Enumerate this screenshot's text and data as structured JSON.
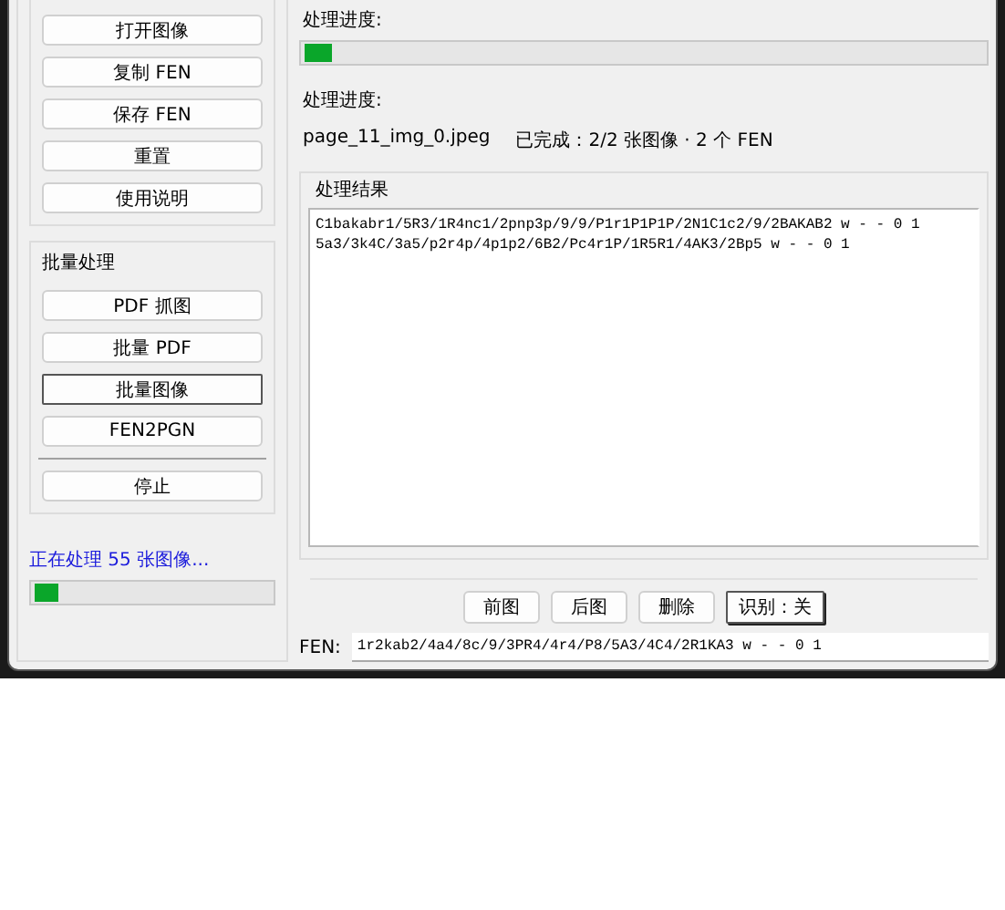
{
  "left_panel": {
    "top_buttons": [
      {
        "label": "打开图像",
        "focused": false
      },
      {
        "label": "复制 FEN",
        "focused": false
      },
      {
        "label": "保存 FEN",
        "focused": false
      },
      {
        "label": "重置",
        "focused": false
      },
      {
        "label": "使用说明",
        "focused": false
      }
    ],
    "batch_group": {
      "title": "批量处理",
      "buttons": [
        {
          "label": "PDF 抓图",
          "focused": false
        },
        {
          "label": "批量 PDF",
          "focused": false
        },
        {
          "label": "批量图像",
          "focused": true
        },
        {
          "label": "FEN2PGN",
          "focused": false
        }
      ],
      "stop_button": {
        "label": "停止",
        "focused": false
      }
    },
    "status": {
      "text": "正在处理 55 张图像...",
      "level": 0.1
    }
  },
  "main": {
    "progress_label": "处理进度:",
    "progress": {
      "level": 0.04
    },
    "progress_label_2": "处理进度:",
    "current_file": "page_11_img_0.jpeg",
    "done_text": "已完成：2/2 张图像 · 2 个 FEN",
    "results": {
      "title": "处理结果",
      "lines": [
        "C1bakabr1/5R3/1R4nc1/2pnp3p/9/9/P1r1P1P1P/2N1C1c2/9/2BAKAB2 w - - 0 1",
        "5a3/3k4C/3a5/p2r4p/4p1p2/6B2/Pc4r1P/1R5R1/4AK3/2Bp5 w - - 0 1"
      ]
    },
    "nav_buttons": [
      {
        "label": "前图",
        "focused": false
      },
      {
        "label": "后图",
        "focused": false
      },
      {
        "label": "删除",
        "focused": false
      },
      {
        "label": "识别：关",
        "focused": true
      }
    ],
    "fen": {
      "label": "FEN:",
      "value": "1r2kab2/4a4/8c/9/3PR4/4r4/P8/5A3/4C4/2R1KA3 w - - 0 1"
    }
  }
}
